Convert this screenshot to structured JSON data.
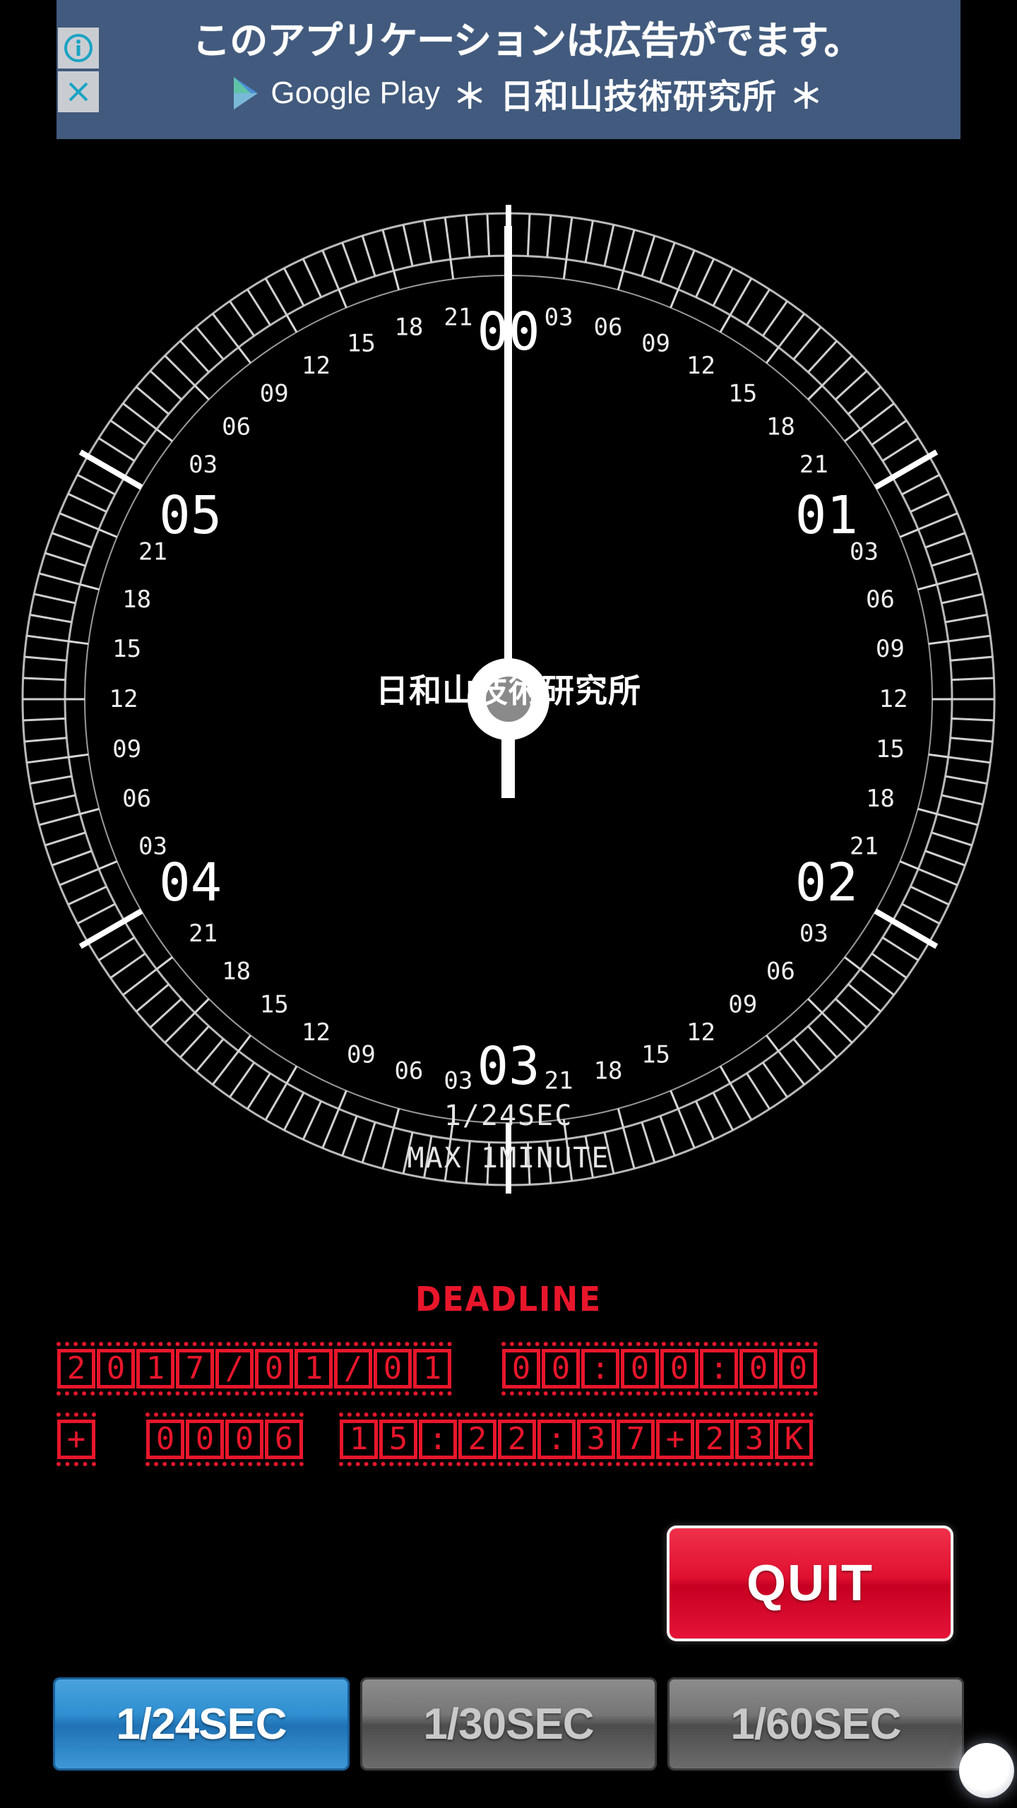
{
  "ad": {
    "headline": "このアプリケーションは広告がでます。",
    "store_label": "Google Play",
    "lab_label": "＊ 日和山技術研究所 ＊",
    "info_icon": "info-icon",
    "close_icon": "close-icon"
  },
  "clock": {
    "brand": "日和山技術研究所",
    "sub_line1": "1/24SEC",
    "sub_line2": "MAX 1MINUTE",
    "major_ticks": [
      "00",
      "01",
      "02",
      "03",
      "04",
      "05"
    ],
    "minor_ticks": [
      "03",
      "06",
      "09",
      "12",
      "15",
      "18",
      "21"
    ],
    "hand_angle_deg": 0,
    "frames_per_second": 24,
    "max_minutes": 1
  },
  "deadline": {
    "title": "DEADLINE",
    "row1": {
      "date": [
        "2",
        "0",
        "1",
        "7",
        "/",
        "0",
        "1",
        "/",
        "0",
        "1"
      ],
      "time": [
        "0",
        "0",
        ":",
        "0",
        "0",
        ":",
        "0",
        "0"
      ]
    },
    "row2": {
      "sign": [
        "+"
      ],
      "counter": [
        "0",
        "0",
        "0",
        "6"
      ],
      "stamp": [
        "1",
        "5",
        ":",
        "2",
        "2",
        ":",
        "3",
        "7",
        "+",
        "2",
        "3",
        "K"
      ]
    },
    "color": "#e8162b"
  },
  "controls": {
    "quit_label": "QUIT",
    "quit_color": "#e01030",
    "modes": [
      {
        "label": "1/24SEC",
        "active": true
      },
      {
        "label": "1/30SEC",
        "active": false
      },
      {
        "label": "1/60SEC",
        "active": false
      }
    ],
    "active_color": "#2f8fd0",
    "inactive_color": "#767676"
  }
}
